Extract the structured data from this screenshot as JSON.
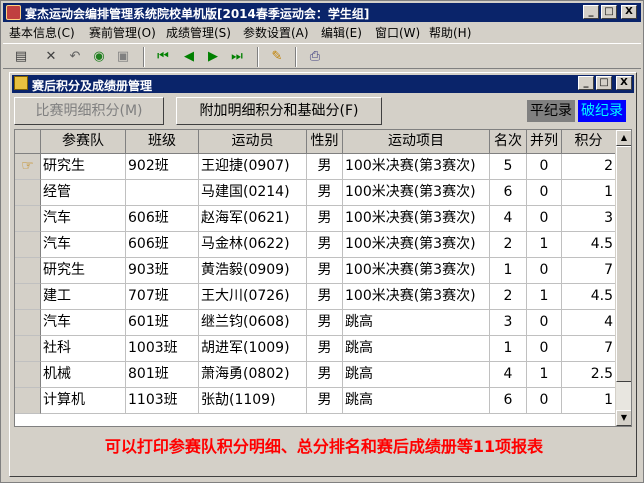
{
  "app": {
    "title": "宴杰运动会编排管理系统院校单机版[2014春季运动会：学生组]",
    "window_buttons": [
      "_",
      "□",
      "X"
    ]
  },
  "menu": [
    "基本信息(C)",
    "赛前管理(O)",
    "成绩管理(S)",
    "参数设置(A)",
    "编辑(E)",
    "窗口(W)",
    "帮助(H)"
  ],
  "toolbar_icons": [
    "new-icon",
    "delete-icon",
    "undo-icon",
    "print-preview-icon",
    "save-icon",
    "first-record-icon",
    "prev-record-icon",
    "next-record-icon",
    "last-record-icon",
    "edit-icon",
    "printer-icon"
  ],
  "child": {
    "title": "赛后积分及成绩册管理",
    "buttons": {
      "compare": "比赛明细积分(M)",
      "extra": "附加明细积分和基础分(F)"
    },
    "legend": {
      "flat": "平纪录",
      "broken": "破纪录"
    }
  },
  "table": {
    "columns": [
      "参赛队",
      "班级",
      "运动员",
      "性别",
      "运动项目",
      "名次",
      "并列",
      "积分"
    ],
    "rows": [
      [
        "研究生",
        "902班",
        "王迎捷(0907)",
        "男",
        "100米决赛(第3赛次)",
        "5",
        "0",
        "2"
      ],
      [
        "经管",
        "",
        "马建国(0214)",
        "男",
        "100米决赛(第3赛次)",
        "6",
        "0",
        "1"
      ],
      [
        "汽车",
        "606班",
        "赵海军(0621)",
        "男",
        "100米决赛(第3赛次)",
        "4",
        "0",
        "3"
      ],
      [
        "汽车",
        "606班",
        "马金林(0622)",
        "男",
        "100米决赛(第3赛次)",
        "2",
        "1",
        "4.5"
      ],
      [
        "研究生",
        "903班",
        "黄浩毅(0909)",
        "男",
        "100米决赛(第3赛次)",
        "1",
        "0",
        "7"
      ],
      [
        "建工",
        "707班",
        "王大川(0726)",
        "男",
        "100米决赛(第3赛次)",
        "2",
        "1",
        "4.5"
      ],
      [
        "汽车",
        "601班",
        "继兰钧(0608)",
        "男",
        "跳高",
        "3",
        "0",
        "4"
      ],
      [
        "社科",
        "1003班",
        "胡进军(1009)",
        "男",
        "跳高",
        "1",
        "0",
        "7"
      ],
      [
        "机械",
        "801班",
        "萧海勇(0802)",
        "男",
        "跳高",
        "4",
        "1",
        "2.5"
      ],
      [
        "计算机",
        "1103班",
        "张劼(1109)",
        "男",
        "跳高",
        "6",
        "0",
        "1"
      ]
    ]
  },
  "footer": "可以打印参赛队积分明细、总分排名和赛后成绩册等11项报表",
  "colors": {
    "title_bar": "#0a246a",
    "legend_flat_bg": "#808080",
    "legend_broken_bg": "#0000ff",
    "legend_broken_fg": "#00ffff",
    "footer_text": "#ff0000"
  }
}
